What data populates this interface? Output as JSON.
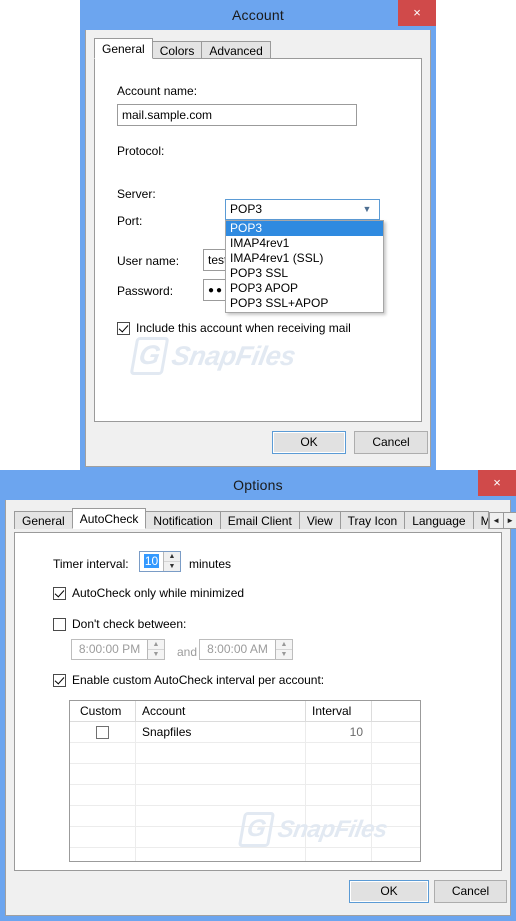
{
  "account_dialog": {
    "title": "Account",
    "close_label": "×",
    "tabs": [
      {
        "label": "General",
        "active": true
      },
      {
        "label": "Colors",
        "active": false
      },
      {
        "label": "Advanced",
        "active": false
      }
    ],
    "fields": {
      "account_name_label": "Account name:",
      "account_name_value": "mail.sample.com",
      "protocol_label": "Protocol:",
      "protocol_value": "POP3",
      "server_label": "Server:",
      "port_label": "Port:",
      "username_label": "User name:",
      "username_value": "tester",
      "password_label": "Password:",
      "password_value": "●●●●●"
    },
    "protocol_options": [
      {
        "label": "POP3",
        "selected": true
      },
      {
        "label": "IMAP4rev1",
        "selected": false
      },
      {
        "label": "IMAP4rev1 (SSL)",
        "selected": false
      },
      {
        "label": "POP3 SSL",
        "selected": false
      },
      {
        "label": "POP3 APOP",
        "selected": false
      },
      {
        "label": "POP3 SSL+APOP",
        "selected": false
      }
    ],
    "include_checkbox": {
      "label": "Include this account when receiving mail",
      "checked": true
    },
    "buttons": {
      "ok": "OK",
      "cancel": "Cancel"
    }
  },
  "options_dialog": {
    "title": "Options",
    "close_label": "×",
    "tabs": [
      {
        "label": "General",
        "active": false
      },
      {
        "label": "AutoCheck",
        "active": true
      },
      {
        "label": "Notification",
        "active": false
      },
      {
        "label": "Email Client",
        "active": false
      },
      {
        "label": "View",
        "active": false
      },
      {
        "label": "Tray Icon",
        "active": false
      },
      {
        "label": "Language",
        "active": false
      },
      {
        "label": "Mouse A",
        "active": false
      }
    ],
    "tab_scroll": {
      "left": "◄",
      "right": "►"
    },
    "timer": {
      "label": "Timer interval:",
      "value": "10",
      "units": "minutes",
      "up": "▲",
      "down": "▼"
    },
    "autocheck_minimized": {
      "label": "AutoCheck only while minimized",
      "checked": true
    },
    "dont_check": {
      "label": "Don't check between:",
      "checked": false
    },
    "time_from": {
      "value": "8:00:00 PM",
      "up": "▲",
      "down": "▼"
    },
    "time_and": "and",
    "time_to": {
      "value": "8:00:00 AM",
      "up": "▲",
      "down": "▼"
    },
    "custom_interval": {
      "label": "Enable custom AutoCheck interval per account:",
      "checked": true
    },
    "grid": {
      "columns": [
        "Custom",
        "Account",
        "Interval",
        ""
      ],
      "rows": [
        {
          "custom_checked": false,
          "account": "Snapfiles",
          "interval": "10"
        }
      ],
      "empty_row_count": 7
    },
    "buttons": {
      "ok": "OK",
      "cancel": "Cancel"
    }
  },
  "watermark": {
    "badge": "G",
    "text": "SnapFiles"
  },
  "colors": {
    "titlebar": "#6ca5ef",
    "close": "#d04a4a",
    "dialog_bg": "#f0f0f0",
    "panel_bg": "#ffffff",
    "selection": "#2f8ae0",
    "focus_border": "#5b9bd5"
  }
}
